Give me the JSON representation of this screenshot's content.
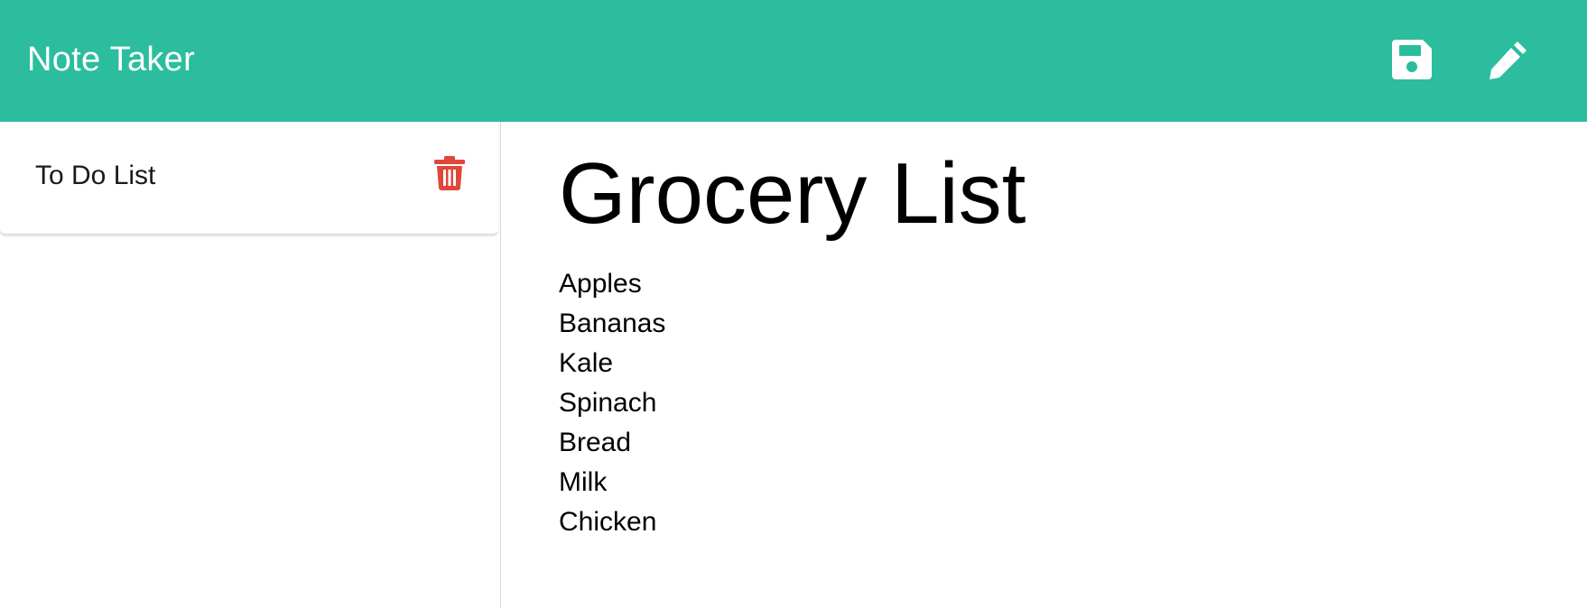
{
  "navbar": {
    "brand": "Note Taker",
    "icons": {
      "save": "save-icon",
      "new": "pencil-icon"
    }
  },
  "colors": {
    "navbar": "#2bbd9e",
    "icon_fill": "#ffffff",
    "delete": "#e0463a"
  },
  "sidebar": {
    "notes": [
      {
        "title": "To Do List",
        "action_icon": "trash-icon"
      }
    ]
  },
  "note": {
    "title": "Grocery List",
    "lines": [
      "Apples",
      "Bananas",
      "Kale",
      "Spinach",
      "Bread",
      "Milk",
      "Chicken"
    ]
  }
}
